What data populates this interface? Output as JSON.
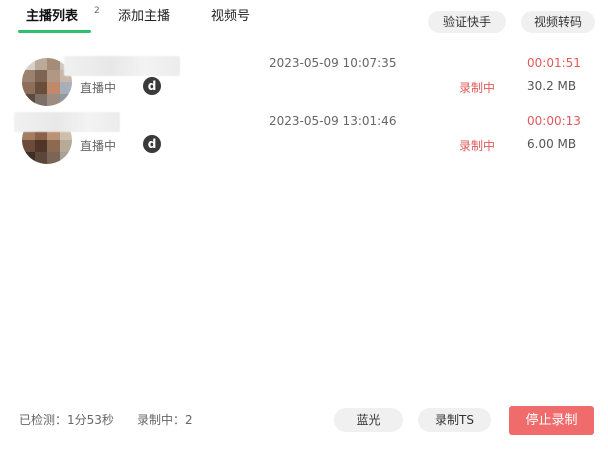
{
  "tabs": [
    {
      "label": "主播列表",
      "badge": "2",
      "active": true
    },
    {
      "label": "添加主播",
      "active": false
    },
    {
      "label": "视频号",
      "active": false
    }
  ],
  "top_buttons": {
    "verify_kuaishou": "验证快手",
    "video_transcode": "视频转码"
  },
  "streamers": [
    {
      "status": "直播中",
      "platform_letter": "d",
      "start_time": "2023-05-09 10:07:35",
      "record_status": "录制中",
      "duration": "00:01:51",
      "file_size": "30.2 MB"
    },
    {
      "status": "直播中",
      "platform_letter": "d",
      "start_time": "2023-05-09 13:01:46",
      "record_status": "录制中",
      "duration": "00:00:13",
      "file_size": "6.00 MB"
    }
  ],
  "footer": {
    "checked": "已检测：1分53秒",
    "recording": "录制中：2",
    "bluray_label": "蓝光",
    "record_ts_label": "录制TS",
    "stop_label": "停止录制"
  },
  "colors": {
    "accent_green": "#2fc06c",
    "recording_red": "#e05a5a",
    "stop_button": "#f06b6b",
    "pill_gray": "#f0f0f0"
  }
}
